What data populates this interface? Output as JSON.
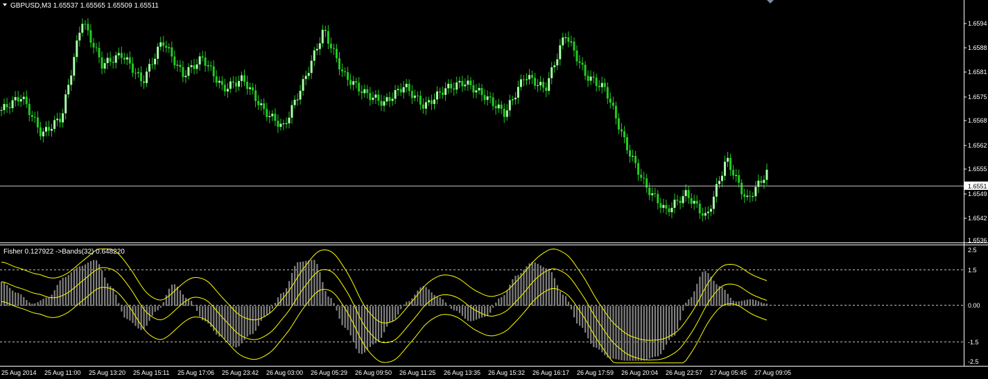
{
  "price_panel": {
    "header": "GBPUSD,M3  1.65537 1.65565 1.65509 1.65511",
    "price_axis_labels": [
      "1.6594",
      "1.6588",
      "1.6581",
      "1.6575",
      "1.6568",
      "1.6562",
      "1.6555",
      "1.6549",
      "1.6542",
      "1.6536"
    ],
    "current_price_label": "1.6551",
    "bar_color": "#22cc22",
    "bar_color_light": "#aaffaa"
  },
  "indicator_panel": {
    "header": "Fisher 0.127922  ->Bands(32) 0.648220",
    "axis_labels": [
      "2.5",
      "1.5",
      "0.00",
      "-1.5",
      "-2.5"
    ],
    "histogram_color": "#808080",
    "bands_color": "#ffff00"
  },
  "time_axis": {
    "labels": [
      "25 Aug 2014",
      "25 Aug 11:00",
      "25 Aug 13:20",
      "25 Aug 15:11",
      "25 Aug 17:06",
      "25 Aug 23:42",
      "26 Aug 03:00",
      "26 Aug 05:29",
      "26 Aug 09:50",
      "26 Aug 11:25",
      "26 Aug 13:35",
      "26 Aug 15:32",
      "26 Aug 16:17",
      "26 Aug 17:59",
      "26 Aug 20:04",
      "26 Aug 22:57",
      "27 Aug 05:45",
      "27 Aug 09:05"
    ]
  },
  "chart_data": [
    {
      "type": "candlestick",
      "title": "GBPUSD,M3",
      "ylim": [
        1.6533,
        1.6598
      ],
      "close_path": [
        1.657,
        1.6574,
        1.6563,
        1.6568,
        1.6596,
        1.6583,
        1.6586,
        1.6578,
        1.659,
        1.658,
        1.6585,
        1.6576,
        1.6579,
        1.657,
        1.6565,
        1.6578,
        1.6593,
        1.658,
        1.6575,
        1.6572,
        1.6577,
        1.6571,
        1.6576,
        1.6578,
        1.6574,
        1.6569,
        1.658,
        1.6576,
        1.6592,
        1.658,
        1.6576,
        1.656,
        1.6548,
        1.6541,
        1.6546,
        1.6539,
        1.6556,
        1.6544,
        1.6552
      ]
    },
    {
      "type": "histogram",
      "title": "Fisher",
      "ylim": [
        -2.7,
        2.7
      ],
      "values": [
        1.1,
        0.6,
        0.1,
        0.4,
        1.3,
        1.8,
        2.1,
        0.9,
        -0.6,
        -1.1,
        -0.2,
        1.0,
        0.3,
        -0.7,
        -1.4,
        -1.9,
        -1.3,
        -0.4,
        0.6,
        2.0,
        2.1,
        0.4,
        -1.0,
        -2.2,
        -1.7,
        -0.7,
        0.2,
        0.9,
        0.4,
        -0.2,
        -0.7,
        -0.5,
        0.4,
        1.4,
        2.0,
        1.7,
        0.5,
        -0.9,
        -1.9,
        -2.4,
        -2.5,
        -2.5,
        -2.3,
        -1.4,
        0.3,
        1.6,
        0.9,
        0.2,
        0.3,
        0.1
      ]
    }
  ]
}
